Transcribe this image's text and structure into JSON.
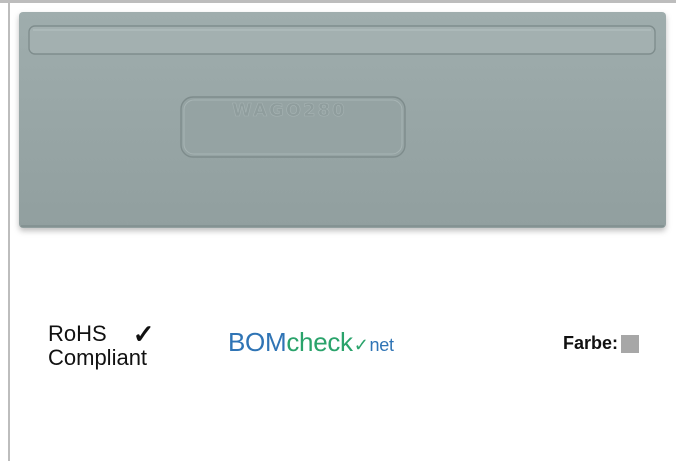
{
  "product": {
    "imprint": "WAGO280",
    "body_color": "#98a6a6",
    "edge_color": "#8a9898",
    "highlight_color": "#a9b6b6"
  },
  "rohs": {
    "line1": "RoHS",
    "check": "✓",
    "line2": "Compliant",
    "icon": "checkmark-icon"
  },
  "bomcheck": {
    "part1": "BOM",
    "part2": "check",
    "tick": "✓",
    "part3": "net",
    "color_blue": "#2f74b5",
    "color_green": "#2aa36b"
  },
  "farbe": {
    "label": "Farbe:",
    "swatch_color": "#a7a7a7"
  }
}
